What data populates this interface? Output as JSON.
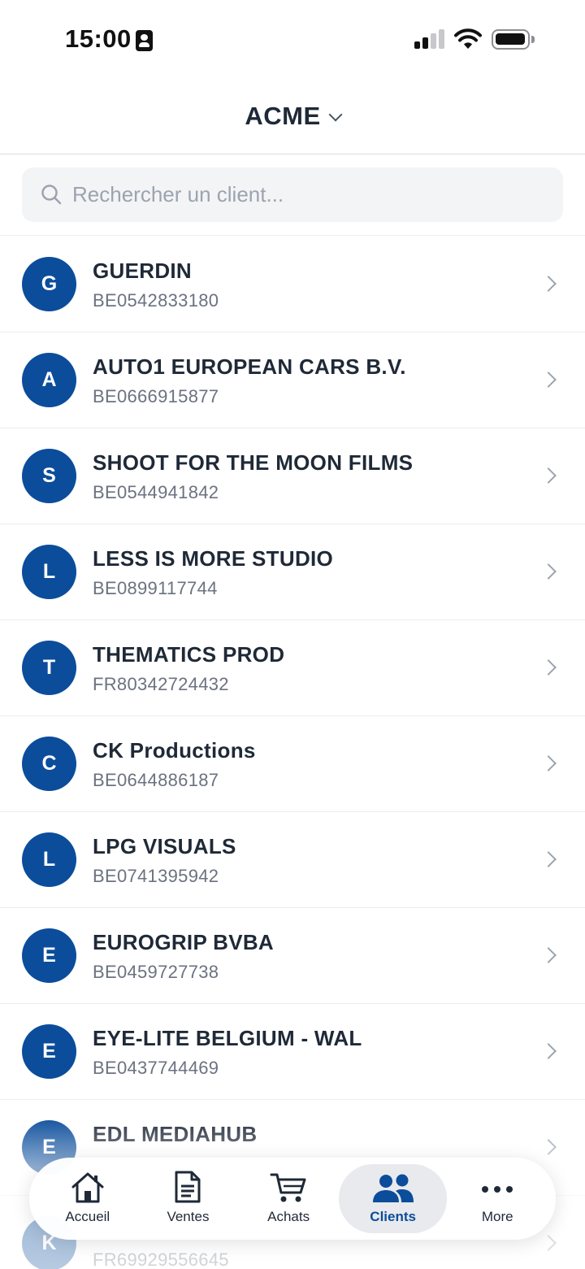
{
  "status_bar": {
    "time": "15:00"
  },
  "header": {
    "org_name": "ACME"
  },
  "search": {
    "placeholder": "Rechercher un client..."
  },
  "clients": [
    {
      "initial": "G",
      "name": "GUERDIN",
      "vat": "BE0542833180"
    },
    {
      "initial": "A",
      "name": "AUTO1 EUROPEAN CARS B.V.",
      "vat": "BE0666915877"
    },
    {
      "initial": "S",
      "name": "SHOOT FOR THE MOON FILMS",
      "vat": "BE0544941842"
    },
    {
      "initial": "L",
      "name": "LESS IS MORE STUDIO",
      "vat": "BE0899117744"
    },
    {
      "initial": "T",
      "name": "THEMATICS PROD",
      "vat": "FR80342724432"
    },
    {
      "initial": "C",
      "name": "CK Productions",
      "vat": "BE0644886187"
    },
    {
      "initial": "L",
      "name": "LPG VISUALS",
      "vat": "BE0741395942"
    },
    {
      "initial": "E",
      "name": "EUROGRIP BVBA",
      "vat": "BE0459727738"
    },
    {
      "initial": "E",
      "name": "EYE-LITE BELGIUM - WAL",
      "vat": "BE0437744469"
    },
    {
      "initial": "E",
      "name": "EDL MEDIAHUB",
      "vat": ""
    },
    {
      "initial": "K",
      "name": "",
      "vat": "FR69929556645"
    }
  ],
  "tab_bar": {
    "home": "Accueil",
    "sales": "Ventes",
    "purchases": "Achats",
    "clients": "Clients",
    "more": "More"
  },
  "colors": {
    "accent": "#0b4d9b",
    "text": "#1f2937",
    "muted": "#6b7280"
  }
}
